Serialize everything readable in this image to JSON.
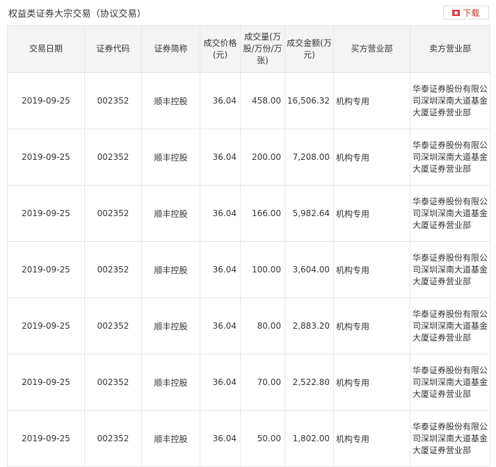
{
  "title": "权益类证券大宗交易（协议交易）",
  "download": {
    "label": "下载",
    "icon": "download-icon"
  },
  "table": {
    "columns": [
      "交易日期",
      "证券代码",
      "证券简称",
      "成交价格(元)",
      "成交量(万股/万份/万张)",
      "成交金额(万元)",
      "买方营业部",
      "卖方营业部"
    ],
    "rows": [
      {
        "date": "2019-09-25",
        "code": "002352",
        "name": "顺丰控股",
        "price": "36.04",
        "volume": "458.00",
        "amount": "16,506.32",
        "buyer": "机构专用",
        "seller": "华泰证券股份有限公司深圳深南大道基金大厦证券营业部"
      },
      {
        "date": "2019-09-25",
        "code": "002352",
        "name": "顺丰控股",
        "price": "36.04",
        "volume": "200.00",
        "amount": "7,208.00",
        "buyer": "机构专用",
        "seller": "华泰证券股份有限公司深圳深南大道基金大厦证券营业部"
      },
      {
        "date": "2019-09-25",
        "code": "002352",
        "name": "顺丰控股",
        "price": "36.04",
        "volume": "166.00",
        "amount": "5,982.64",
        "buyer": "机构专用",
        "seller": "华泰证券股份有限公司深圳深南大道基金大厦证券营业部"
      },
      {
        "date": "2019-09-25",
        "code": "002352",
        "name": "顺丰控股",
        "price": "36.04",
        "volume": "100.00",
        "amount": "3,604.00",
        "buyer": "机构专用",
        "seller": "华泰证券股份有限公司深圳深南大道基金大厦证券营业部"
      },
      {
        "date": "2019-09-25",
        "code": "002352",
        "name": "顺丰控股",
        "price": "36.04",
        "volume": "80.00",
        "amount": "2,883.20",
        "buyer": "机构专用",
        "seller": "华泰证券股份有限公司深圳深南大道基金大厦证券营业部"
      },
      {
        "date": "2019-09-25",
        "code": "002352",
        "name": "顺丰控股",
        "price": "36.04",
        "volume": "70.00",
        "amount": "2,522.80",
        "buyer": "机构专用",
        "seller": "华泰证券股份有限公司深圳深南大道基金大厦证券营业部"
      },
      {
        "date": "2019-09-25",
        "code": "002352",
        "name": "顺丰控股",
        "price": "36.04",
        "volume": "50.00",
        "amount": "1,802.00",
        "buyer": "机构专用",
        "seller": "华泰证券股份有限公司深圳深南大道基金大厦证券营业部"
      }
    ]
  },
  "colors": {
    "header_bg": "#f4f4f4",
    "border": "#e6e6e6",
    "accent": "#e0393e"
  }
}
